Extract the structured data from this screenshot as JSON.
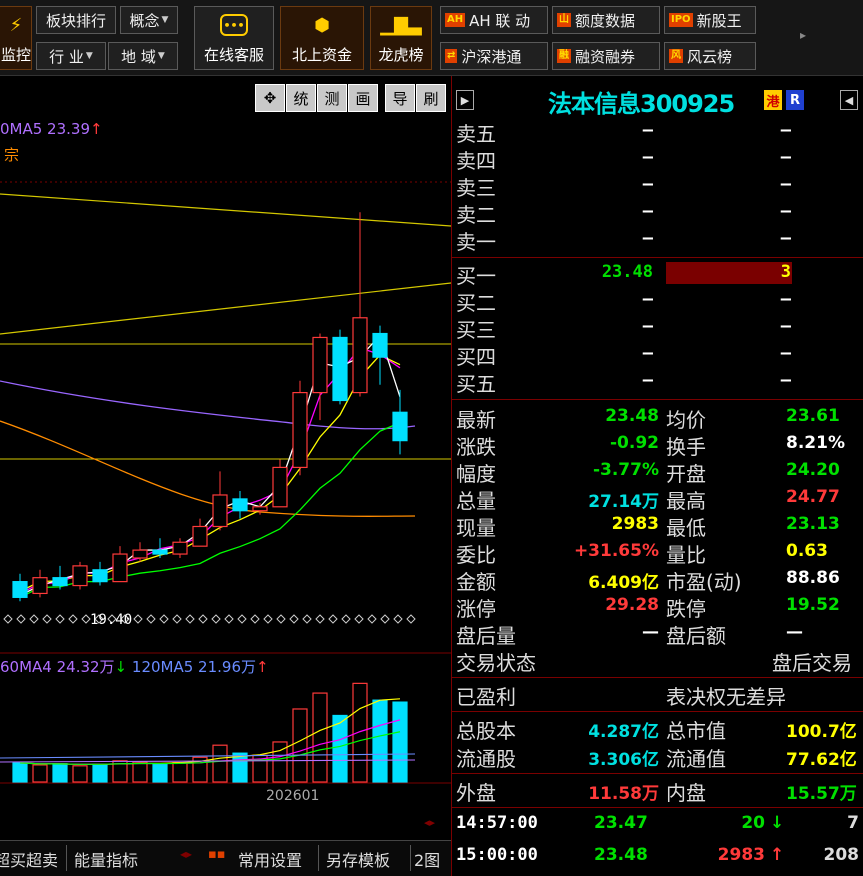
{
  "toolbar": {
    "row1": [
      {
        "label": "板块排行"
      },
      {
        "label": "概念",
        "dropdown": true
      }
    ],
    "row2": [
      {
        "label": "行 业",
        "dropdown": true
      },
      {
        "label": "地 域",
        "dropdown": true
      }
    ],
    "partial_left": "监控",
    "big_buttons": [
      {
        "label": "在线客服",
        "icon": "chat-icon"
      },
      {
        "label": "北上资金",
        "icon": "capital-flow-icon"
      },
      {
        "label": "龙虎榜",
        "icon": "bar-ranking-icon"
      }
    ],
    "right_row1": [
      {
        "label": "AH 联 动",
        "icon_text": "AH"
      },
      {
        "label": "额度数据",
        "icon_text": "山"
      },
      {
        "label": "新股王",
        "icon_text": "IPO"
      }
    ],
    "right_row2": [
      {
        "label": "沪深港通",
        "icon_text": "⇄"
      },
      {
        "label": "融资融券",
        "icon_text": "融"
      },
      {
        "label": "风云榜",
        "icon_text": "风"
      }
    ]
  },
  "chart": {
    "tools": [
      "✥",
      "统",
      "测",
      "画",
      "导",
      "刷"
    ],
    "ma_legend": "0MA5 23.39",
    "ma_legend_arrow": "↑",
    "tag": "宗",
    "low_label": "19.40",
    "vol_legend_1": "60MA4 24.32万",
    "vol_legend_1_arrow": "↓",
    "vol_legend_2": "120MA5 21.96万",
    "vol_legend_2_arrow": "↑",
    "date_label": "202601",
    "bottom_tabs": [
      {
        "label": "超买超卖"
      },
      {
        "label": "能量指标"
      },
      {
        "label": "常用设置"
      },
      {
        "label": "另存模板"
      },
      {
        "label": "2图"
      }
    ],
    "colors": {
      "up": "#ff3a3a",
      "down": "#00e0ff",
      "ma5": "#ffffff",
      "ma10": "#ffff00",
      "ma20": "#ff00ff",
      "ma30": "#00ff00",
      "ma60": "#ff8c00",
      "ma120": "#9966ff"
    }
  },
  "chart_data": {
    "type": "candlestick",
    "title": "",
    "price_candles": [
      {
        "open": 19.9,
        "close": 19.5,
        "high": 20.1,
        "low": 19.4
      },
      {
        "open": 19.6,
        "close": 20.0,
        "high": 20.2,
        "low": 19.5
      },
      {
        "open": 20.0,
        "close": 19.8,
        "high": 20.3,
        "low": 19.7
      },
      {
        "open": 19.8,
        "close": 20.3,
        "high": 20.4,
        "low": 19.7
      },
      {
        "open": 20.2,
        "close": 19.9,
        "high": 20.4,
        "low": 19.8
      },
      {
        "open": 19.9,
        "close": 20.6,
        "high": 20.8,
        "low": 19.9
      },
      {
        "open": 20.5,
        "close": 20.7,
        "high": 20.9,
        "low": 20.4
      },
      {
        "open": 20.7,
        "close": 20.6,
        "high": 21.0,
        "low": 20.5
      },
      {
        "open": 20.6,
        "close": 20.9,
        "high": 21.0,
        "low": 20.5
      },
      {
        "open": 20.8,
        "close": 21.3,
        "high": 21.5,
        "low": 20.8
      },
      {
        "open": 21.3,
        "close": 22.1,
        "high": 22.7,
        "low": 21.2
      },
      {
        "open": 22.0,
        "close": 21.7,
        "high": 22.2,
        "low": 21.5
      },
      {
        "open": 21.7,
        "close": 21.8,
        "high": 21.9,
        "low": 21.6
      },
      {
        "open": 21.8,
        "close": 22.8,
        "high": 23.0,
        "low": 21.8
      },
      {
        "open": 22.8,
        "close": 24.7,
        "high": 25.0,
        "low": 22.6
      },
      {
        "open": 24.7,
        "close": 26.1,
        "high": 26.2,
        "low": 24.0
      },
      {
        "open": 26.1,
        "close": 24.5,
        "high": 26.3,
        "low": 24.4
      },
      {
        "open": 24.7,
        "close": 26.6,
        "high": 29.28,
        "low": 24.6
      },
      {
        "open": 26.2,
        "close": 25.6,
        "high": 26.4,
        "low": 24.9
      },
      {
        "open": 24.2,
        "close": 23.48,
        "high": 24.77,
        "low": 23.13
      }
    ],
    "volumes": [
      6.5,
      5.8,
      6.2,
      5.5,
      6.0,
      7.2,
      6.8,
      6.1,
      6.6,
      8.4,
      12.5,
      9.8,
      9.1,
      13.6,
      24.8,
      30.2,
      22.6,
      33.5,
      27.8,
      27.14
    ],
    "ylabel": "",
    "xlabel": ""
  },
  "quote": {
    "title": "法本信息300925",
    "badge_hk": "港",
    "badge_r": "R",
    "asks": [
      {
        "label": "卖五",
        "price": "—",
        "vol": "—"
      },
      {
        "label": "卖四",
        "price": "—",
        "vol": "—"
      },
      {
        "label": "卖三",
        "price": "—",
        "vol": "—"
      },
      {
        "label": "卖二",
        "price": "—",
        "vol": "—"
      },
      {
        "label": "卖一",
        "price": "—",
        "vol": "—"
      }
    ],
    "bids": [
      {
        "label": "买一",
        "price": "23.48",
        "vol": "3"
      },
      {
        "label": "买二",
        "price": "—",
        "vol": "—"
      },
      {
        "label": "买三",
        "price": "—",
        "vol": "—"
      },
      {
        "label": "买四",
        "price": "—",
        "vol": "—"
      },
      {
        "label": "买五",
        "price": "—",
        "vol": "—"
      }
    ],
    "stats": [
      {
        "l1": "最新",
        "v1": "23.48",
        "c1": "green",
        "l2": "均价",
        "v2": "23.61",
        "c2": "green"
      },
      {
        "l1": "涨跌",
        "v1": "-0.92",
        "c1": "green",
        "l2": "换手",
        "v2": "8.21%",
        "c2": "white"
      },
      {
        "l1": "幅度",
        "v1": "-3.77%",
        "c1": "green",
        "l2": "开盘",
        "v2": "24.20",
        "c2": "green"
      },
      {
        "l1": "总量",
        "v1": "27.14万",
        "c1": "cyan",
        "l2": "最高",
        "v2": "24.77",
        "c2": "red"
      },
      {
        "l1": "现量",
        "v1": "2983",
        "c1": "yellow",
        "l2": "最低",
        "v2": "23.13",
        "c2": "green"
      },
      {
        "l1": "委比",
        "v1": "+31.65%",
        "c1": "red",
        "l2": "量比",
        "v2": "0.63",
        "c2": "yellow"
      },
      {
        "l1": "金额",
        "v1": "6.409亿",
        "c1": "yellow",
        "l2": "市盈(动)",
        "v2": "88.86",
        "c2": "white"
      },
      {
        "l1": "涨停",
        "v1": "29.28",
        "c1": "red",
        "l2": "跌停",
        "v2": "19.52",
        "c2": "green"
      },
      {
        "l1": "盘后量",
        "v1": "—",
        "c1": "white",
        "l2": "盘后额",
        "v2": "—",
        "c2": "white"
      }
    ],
    "trade_status_label": "交易状态",
    "trade_status_value": "盘后交易",
    "profit_label": "已盈利",
    "vote_label": "表决权无差异",
    "share_stats": [
      {
        "l1": "总股本",
        "v1": "4.287亿",
        "l2": "总市值",
        "v2": "100.7亿"
      },
      {
        "l1": "流通股",
        "v1": "3.306亿",
        "l2": "流通值",
        "v2": "77.62亿"
      }
    ],
    "outer_label": "外盘",
    "outer_value": "11.58万",
    "inner_label": "内盘",
    "inner_value": "15.57万",
    "ticks": [
      {
        "time": "14:57:00",
        "price": "23.47",
        "vol": "20",
        "arrow": "↓",
        "count": "7",
        "color": "green"
      },
      {
        "time": "15:00:00",
        "price": "23.48",
        "vol": "2983",
        "arrow": "↑",
        "count": "208",
        "color": "red"
      }
    ]
  }
}
